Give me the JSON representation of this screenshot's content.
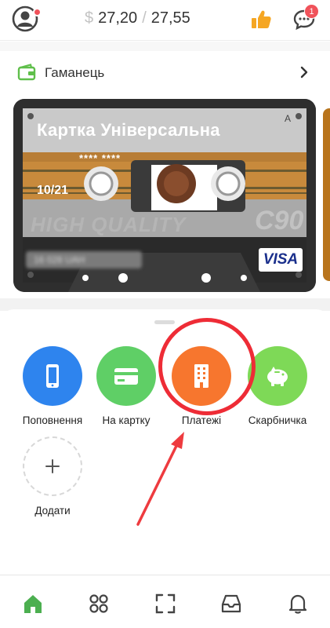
{
  "header": {
    "balance_currency": "$",
    "balance_current": "27,20",
    "balance_separator": "/",
    "balance_total": "27,55",
    "chat_badge": "1"
  },
  "wallet": {
    "title": "Гаманець"
  },
  "card": {
    "name": "Картка Універсальна",
    "corner_letter": "A",
    "number_masked": "**** ****",
    "expiry": "10/21",
    "tape_text_1": "HIGH QUALITY",
    "tape_text_2": "C90",
    "balance_blurred": "16 028 UAH",
    "network": "VISA"
  },
  "actions": [
    {
      "label": "Поповнення",
      "icon": "phone-icon",
      "color": "#2e84ee"
    },
    {
      "label": "На картку",
      "icon": "card-icon",
      "color": "#5fcf66"
    },
    {
      "label": "Платежі",
      "icon": "building-icon",
      "color": "#f7762e"
    },
    {
      "label": "Скарбничка",
      "icon": "piggy-bank-icon",
      "color": "#7ed957"
    }
  ],
  "add_action": {
    "label": "Додати",
    "icon": "plus-icon"
  },
  "bottom_nav": [
    {
      "name": "home",
      "icon": "home-icon",
      "active": true,
      "color": "#4caf50"
    },
    {
      "name": "apps",
      "icon": "grid-icon",
      "active": false
    },
    {
      "name": "scan",
      "icon": "scan-icon",
      "active": false
    },
    {
      "name": "inbox",
      "icon": "inbox-icon",
      "active": false
    },
    {
      "name": "notifications",
      "icon": "bell-icon",
      "active": false
    }
  ]
}
